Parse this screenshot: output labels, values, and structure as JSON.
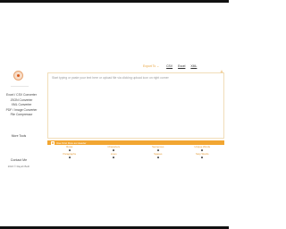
{
  "sidebar": {
    "nav_items": [
      {
        "label": "Excel / CSV Converter"
      },
      {
        "label": "JSON Converter"
      },
      {
        "label": "XML Converter"
      },
      {
        "label": "PDF / Image Converter"
      },
      {
        "label": "File Compressor"
      }
    ],
    "more_tools": "More Tools",
    "contact": "Contact Me",
    "copyright": "2024 © Rayah Beth"
  },
  "toolbar": {
    "export_label": "Export To",
    "export_arrow": "⌄",
    "option_csv": "CSV",
    "option_excel": "Excel",
    "option_xml": "XML"
  },
  "editor": {
    "placeholder": "Start typing or paste your text here or upload file via clicking upload icon on right corner"
  },
  "options_bar": {
    "label": "Use First Row as Header"
  },
  "options": {
    "row1": [
      "Rows",
      "Characters",
      "Sentences",
      "Unique Words"
    ],
    "row2": [
      "Paragraphs",
      "Lines",
      "Spaces",
      "Stop Words"
    ]
  },
  "colors": {
    "accent": "#f2a632",
    "border": "#f1ddb8"
  },
  "icons": {
    "download": "download-icon",
    "logo": "logo-icon"
  }
}
